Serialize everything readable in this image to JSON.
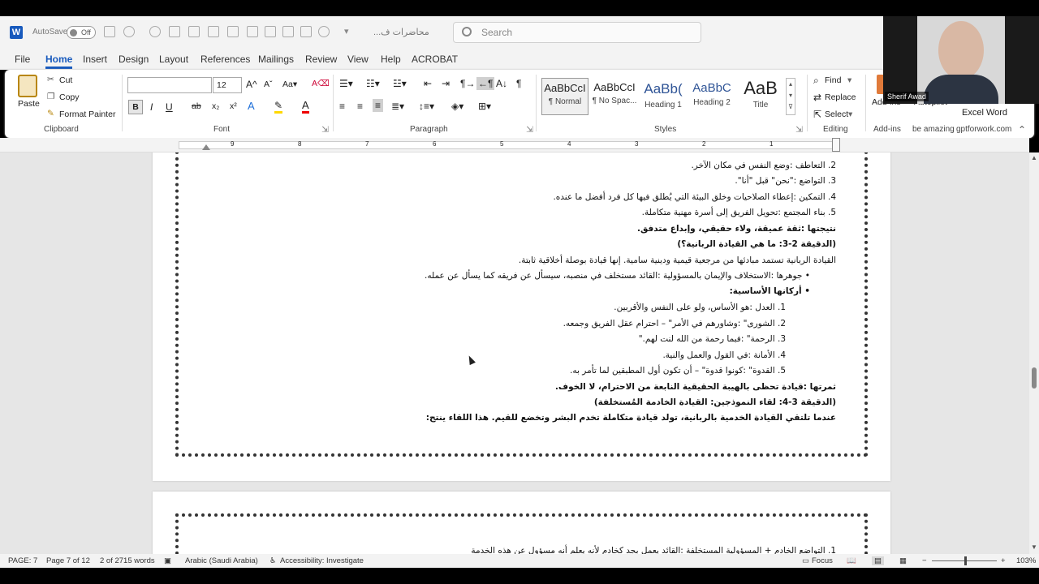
{
  "titlebar": {
    "app_icon": "word-icon",
    "autosave_label": "AutoSave",
    "autosave_state": "Off",
    "doc_name": "محاضرات ف...",
    "search_placeholder": "Search"
  },
  "menu": {
    "tabs": [
      "File",
      "Home",
      "Insert",
      "Design",
      "Layout",
      "References",
      "Mailings",
      "Review",
      "View",
      "Help",
      "ACROBAT"
    ],
    "active": "Home"
  },
  "ribbon": {
    "clipboard": {
      "paste": "Paste",
      "cut": "Cut",
      "copy": "Copy",
      "format_painter": "Format Painter",
      "group": "Clipboard"
    },
    "font": {
      "font_name": "",
      "font_size": "12",
      "group": "Font"
    },
    "paragraph": {
      "group": "Paragraph"
    },
    "styles": {
      "items": [
        {
          "sample": "AaBbCcI",
          "name": "¶ Normal"
        },
        {
          "sample": "AaBbCcI",
          "name": "¶ No Spac..."
        },
        {
          "sample": "AaBb(",
          "name": "Heading 1"
        },
        {
          "sample": "AaBbC",
          "name": "Heading 2"
        },
        {
          "sample": "AaB",
          "name": "Title"
        }
      ],
      "group": "Styles"
    },
    "editing": {
      "find": "Find",
      "replace": "Replace",
      "select": "Select",
      "group": "Editing"
    },
    "addins": {
      "label": "Add-ins",
      "group": "Add-ins"
    },
    "extras": {
      "be_amazing": "be amazing",
      "gptforwork": "gptforwork.com",
      "excel_word": "Excel Word",
      "add_label": "Add-ins",
      "autopilot": "Autopilot"
    }
  },
  "ruler": {
    "numbers": [
      "9",
      "8",
      "7",
      "6",
      "5",
      "4",
      "3",
      "2",
      "1"
    ]
  },
  "document": {
    "lines": [
      {
        "text": "2.  التعاطف :وضع النفس في مكان الآخر.",
        "bold": false
      },
      {
        "text": "3.  التواضع :\"نحن\" قبل \"أنا\".",
        "bold": false
      },
      {
        "text": "4.  التمكين :إعطاء الصلاحيات وخلق البيئة التي يُطلق فيها كل فرد أفضل ما عنده.",
        "bold": false
      },
      {
        "text": "5.  بناء المجتمع :تحويل الفريق إلى أسرة مهنية متكاملة.",
        "bold": false
      },
      {
        "text": "نتيجتها :ثقة عميقة، ولاء حقيقي، وإبداع متدفق.",
        "bold": true
      },
      {
        "text": "(الدقيقة 2-3: ما هي القيادة الربانية؟)",
        "bold": true
      },
      {
        "text": "القيادة الربانية تستمد مبادئها من مرجعية قيمية ودينية سامية. إنها قيادة بوصلة أخلاقية ثابتة.",
        "bold": false
      },
      {
        "text": "•   جوهرها :الاستخلاف والإيمان بالمسؤولية :القائد مستخلف في منصبه، سيسأل عن فريقه كما يسأل عن عمله.",
        "bold": false
      },
      {
        "text": "•   أركانها الأساسية:",
        "bold": true
      },
      {
        "text": "1.  العدل :هو الأساس، ولو على النفس والأقربين.",
        "bold": false
      },
      {
        "text": "2.  الشورى\" :وشاورهم في الأمر\" – احترام عقل الفريق وجمعه.",
        "bold": false
      },
      {
        "text": "3.  الرحمة\" :فبما رحمة من الله لنت لهم.\"",
        "bold": false
      },
      {
        "text": "4.  الأمانة :في القول والعمل والنية.",
        "bold": false
      },
      {
        "text": "5.  القدوة\" :كونوا قدوة\" – أن تكون أول المطبقين لما تأمر به.",
        "bold": false
      },
      {
        "text": "ثمرتها :قيادة تحظى بالهيبة الحقيقية النابعة من الاحترام، لا الخوف.",
        "bold": true
      },
      {
        "text": "(الدقيقة 3-4: لقاء النموذجين: القيادة الخادمة المُستخلفة)",
        "bold": true
      },
      {
        "text": "عندما تلتقي القيادة الخدمية بالربانية، تولد قيادة متكاملة تخدم البشر وتخضع للقيم. هذا اللقاء ينتج:",
        "bold": true
      }
    ],
    "next_page_line": "1.  التواضع الخادم + المسؤولية المستخلفة :القائد يعمل بجد كخادم لأنه يعلم أنه مسؤول عن هذه الخدمة"
  },
  "status": {
    "page": "PAGE: 7",
    "page_of": "Page 7 of 12",
    "words": "2 of 2715 words",
    "language": "Arabic (Saudi Arabia)",
    "accessibility": "Accessibility: Investigate",
    "focus": "Focus",
    "zoom": "103%"
  },
  "video": {
    "name": "Sherif Awad"
  }
}
